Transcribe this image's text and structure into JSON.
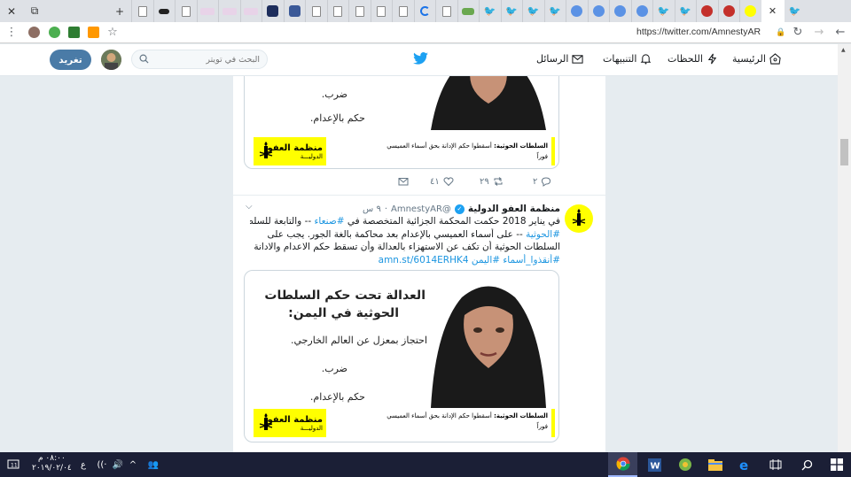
{
  "browser": {
    "url": "https://twitter.com/AmnestyAR",
    "tab_icons": [
      "close-icon",
      "twitter",
      "twitter",
      "twitter",
      "twitter",
      "twitter",
      "alert",
      "alert",
      "un",
      "un",
      "un",
      "un",
      "un",
      "un",
      "twitter",
      "twitter",
      "twitter",
      "twitter",
      "page",
      "blue",
      "page",
      "page",
      "page",
      "page",
      "page",
      "page",
      "dark",
      "facebook",
      "page",
      "pink",
      "pink",
      "pink",
      "page",
      "dark-flag",
      "page",
      "page",
      "new-tab"
    ],
    "minimize_label": "⧉",
    "close_label": "✕",
    "new_tab_label": "+"
  },
  "twitter": {
    "nav": {
      "home": "الرئيسية",
      "moments": "اللحظات",
      "notifications": "التنبيهات",
      "messages": "الرسائل"
    },
    "search_placeholder": "البحث في تويتر",
    "tweet_button": "تغريد"
  },
  "card1": {
    "line_top": "ضرب.",
    "line_bottom": "حكم بالإعدام.",
    "logo_line1": "منظمة العفو",
    "logo_line2": "الدوليـــة",
    "strip_label": "السلطات الحوثية:",
    "strip_text": "أسقطوا حكم الإدانة بحق أسماء العميسي",
    "strip_text2": "فوراً"
  },
  "actions1": {
    "reply_count": "٢",
    "retweet_count": "٢٩",
    "like_count": "٤١"
  },
  "tweet2": {
    "name": "منظمة العفو الدولية",
    "handle": "@AmnestyAR",
    "time": "٩ س",
    "body_lines": [
      {
        "pre": "في يناير 2018 حكمت المحكمة الجزائية المتخصصة في ",
        "link": "#صنعاء",
        "post": " -- والتابعة للسلطات"
      },
      {
        "pre": "",
        "link": "#الحوثية",
        "post": " -- على أسماء العميسي بالإعدام بعد محاكمة بالغة الجور. يجب على"
      },
      {
        "pre": "السلطات الحوثية أن تكف عن الاستهزاء بالعدالة وأن تسقط حكم الاعدام والادانة",
        "link": "",
        "post": ""
      },
      {
        "pre": "",
        "link": "#أنقذوا_أسماء #اليمن amn.st/6014ERHK4",
        "post": ""
      }
    ]
  },
  "card2": {
    "headline1": "العدالة تحت حكم السلطات",
    "headline2": "الحوثية في اليمن:",
    "line1": "احتجاز بمعزل عن العالم الخارجي.",
    "line2": "ضرب.",
    "line3": "حكم بالإعدام.",
    "logo_line1": "منظمة العفو",
    "logo_line2": "الدوليـــة",
    "strip_label": "السلطات الحوثية:",
    "strip_text": "أسقطوا حكم الإدانة بحق أسماء العميسي",
    "strip_text2": "فوراً"
  },
  "taskbar": {
    "time": "٠٨:٠٠ م",
    "date": "٢٠١٩/٠٢/٠٤",
    "lang": "ع"
  },
  "colors": {
    "twitter_blue": "#1da1f2",
    "amnesty_yellow": "#ffff00",
    "tweet_button": "#4a7ba7"
  }
}
